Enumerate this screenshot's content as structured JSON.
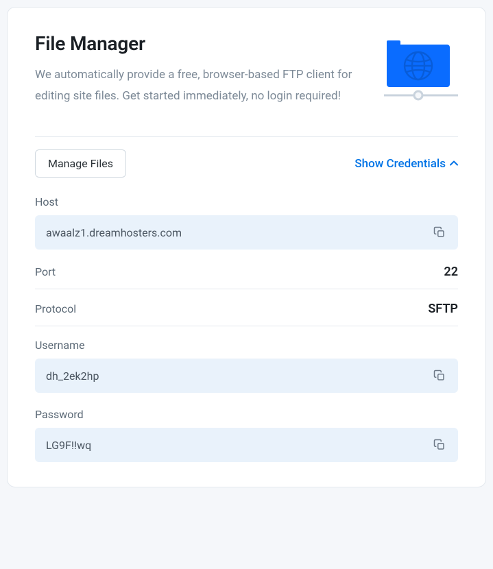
{
  "header": {
    "title": "File Manager",
    "description": "We automatically provide a free, browser-based FTP client for editing site files. Get started immediately, no login required!"
  },
  "actions": {
    "manage_files_label": "Manage Files",
    "show_credentials_label": "Show Credentials"
  },
  "fields": {
    "host": {
      "label": "Host",
      "value": "awaalz1.dreamhosters.com"
    },
    "port": {
      "label": "Port",
      "value": "22"
    },
    "protocol": {
      "label": "Protocol",
      "value": "SFTP"
    },
    "username": {
      "label": "Username",
      "value": "dh_2ek2hp"
    },
    "password": {
      "label": "Password",
      "value": "LG9F!!wq"
    }
  }
}
